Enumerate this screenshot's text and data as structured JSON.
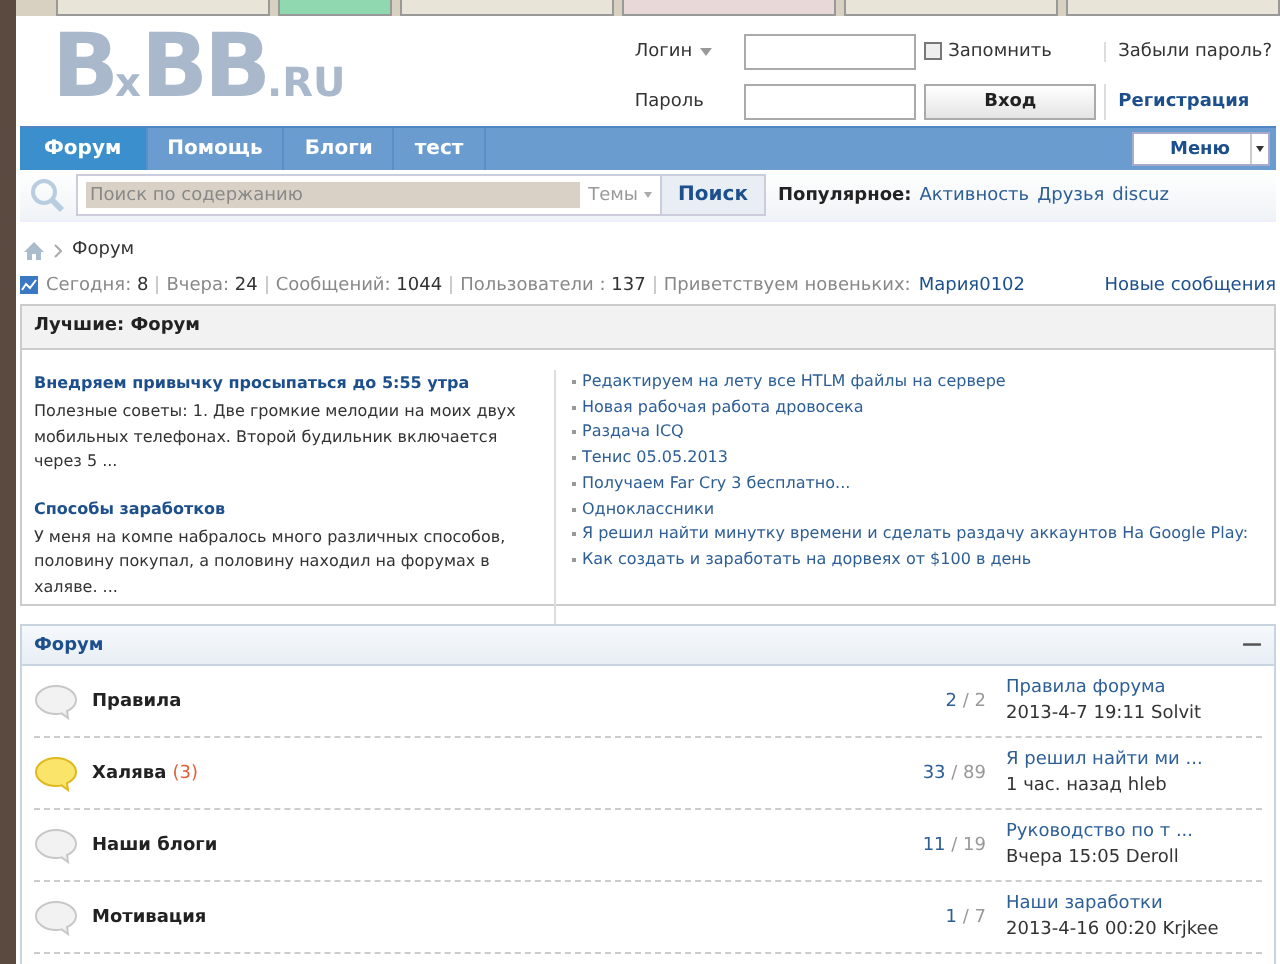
{
  "header": {
    "logo": "B$_{x}$BB$_{.RU}$",
    "login": {
      "login_label": "Логин",
      "password_label": "Пароль",
      "remember": {
        "label": "Запомнить",
        "checked": false
      },
      "forgot": "Забыли пароль?",
      "submit": "Вход",
      "register": "Регистрация"
    }
  },
  "nav": {
    "tabs": [
      {
        "label": "Форум",
        "selected": true
      },
      {
        "label": "Помощь",
        "selected": false
      },
      {
        "label": "Блоги",
        "selected": false
      },
      {
        "label": "тест",
        "selected": false
      }
    ],
    "menu_button": "Меню"
  },
  "search": {
    "placeholder": "Поиск по содержанию",
    "scope": "Темы",
    "button": "Поиск",
    "popular_label": "Популярное:",
    "popular": [
      "Активность",
      "Друзья",
      "discuz"
    ]
  },
  "breadcrumb": [
    "Форум"
  ],
  "stats": {
    "items": [
      {
        "label": "Сегодня:",
        "value": "8"
      },
      {
        "label": "Вчера:",
        "value": "24"
      },
      {
        "label": "Сообщений:",
        "value": "1044"
      },
      {
        "label": "Пользователи :",
        "value": "137"
      }
    ],
    "welcome_label": "Приветствуем новеньких:",
    "welcome_user": "Мария0102",
    "new_posts": "Новые сообщения"
  },
  "best": {
    "title": "Лучшие: Форум",
    "articles": [
      {
        "title": "Внедряем привычку просыпаться до 5:55 утра",
        "text": "Полезные советы: 1. Две громкие мелодии на моих двух мобильных телефонах. Второй будильник включается через 5 ..."
      },
      {
        "title": "Способы заработков",
        "text": "У меня на компе набралось много различных способов, половину покупал, а половину находил на форумах в халяве. ..."
      }
    ],
    "links": [
      "Редактируем на лету все HTLM файлы на сервере",
      "Новая рабочая работа дровосека",
      "Раздача ICQ",
      "Тенис 05.05.2013",
      "Получаем Far Cry 3 бесплатно...",
      "Одноклассники",
      "Я решил найти минутку времени и сделать раздачу аккаунтов На Google Play:",
      "Как создать и заработать на дорвеях от $100 в день"
    ]
  },
  "forum": {
    "title": "Форум",
    "collapse": "—",
    "rows": [
      {
        "name": "Правила",
        "has_new": false,
        "topics": "2",
        "separator": "/",
        "posts": "2",
        "last_title": "Правила форума",
        "last_meta": "2013-4-7 19:11 Solvit"
      },
      {
        "name": "Халява",
        "new_count": "(3)",
        "has_new": true,
        "topics": "33",
        "separator": "/",
        "posts": "89",
        "last_title": "Я решил найти ми ...",
        "last_meta": "1 час. назад hleb"
      },
      {
        "name": "Наши блоги",
        "has_new": false,
        "topics": "11",
        "separator": "/",
        "posts": "19",
        "last_title": "Руководство по т ...",
        "last_meta": "Вчера 15:05 Deroll"
      },
      {
        "name": "Мотивация",
        "has_new": false,
        "topics": "1",
        "separator": "/",
        "posts": "7",
        "last_title": "Наши заработки",
        "last_meta": "2013-4-16 00:20 Krjkee"
      }
    ]
  }
}
